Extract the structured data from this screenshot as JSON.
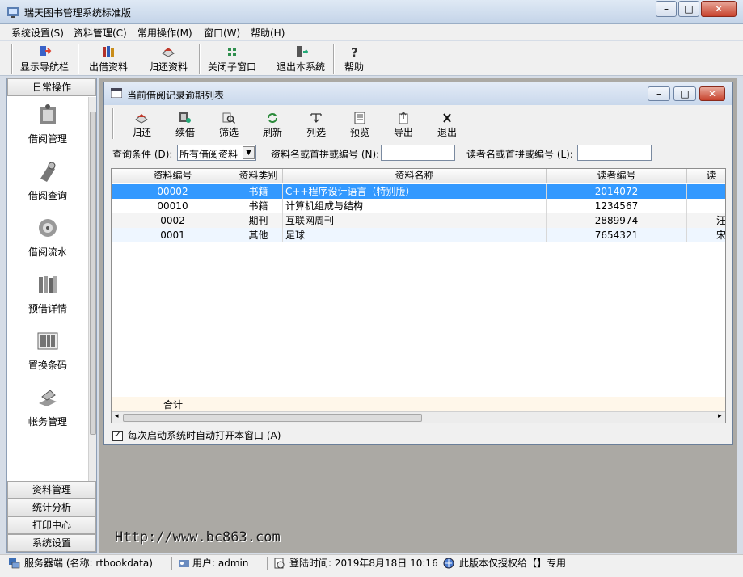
{
  "window": {
    "title": "瑞天图书管理系统标准版",
    "min": "–",
    "max": "□",
    "close": "✕"
  },
  "menu": [
    "系统设置(S)",
    "资料管理(C)",
    "常用操作(M)",
    "窗口(W)",
    "帮助(H)"
  ],
  "toolbar": [
    "显示导航栏",
    "出借资料",
    "归还资料",
    "关闭子窗口",
    "退出本系统",
    "帮助"
  ],
  "left_panel": {
    "header": "日常操作",
    "items": [
      "借阅管理",
      "借阅查询",
      "借阅流水",
      "预借详情",
      "置换条码",
      "帐务管理"
    ],
    "bottom": [
      "资料管理",
      "统计分析",
      "打印中心",
      "系统设置"
    ]
  },
  "child": {
    "title": "当前借阅记录逾期列表",
    "toolbar": [
      "归还",
      "续借",
      "筛选",
      "刷新",
      "列选",
      "预览",
      "导出",
      "退出"
    ],
    "query": {
      "cond_label": "查询条件 (D):",
      "cond_value": "所有借阅资料",
      "name_label": "资料名或首拼或编号 (N):",
      "reader_label": "读者名或首拼或编号 (L):"
    },
    "columns": [
      "资料编号",
      "资料类别",
      "资料名称",
      "读者编号",
      "读"
    ],
    "rows": [
      [
        "00002",
        "书籍",
        "C++程序设计语言（特别版）",
        "2014072",
        ""
      ],
      [
        "00010",
        "书籍",
        "计算机组成与结构",
        "1234567",
        ""
      ],
      [
        "0002",
        "期刊",
        "互联网周刊",
        "2889974",
        "汪"
      ],
      [
        "0001",
        "其他",
        "足球",
        "7654321",
        "宋"
      ]
    ],
    "total_label": "合计",
    "auto_open": "每次启动系统时自动打开本窗口 (A)"
  },
  "watermark": "Http://www.bc863.com",
  "status": [
    "服务器端 (名称: rtbookdata)",
    "用户: admin",
    "登陆时间: 2019年8月18日  10:16",
    "此版本仅授权给【】专用"
  ],
  "colors": {
    "selected_row": "#3399ff",
    "alt_row": "#eef6ff",
    "window_bg": "#f0f0f0"
  }
}
